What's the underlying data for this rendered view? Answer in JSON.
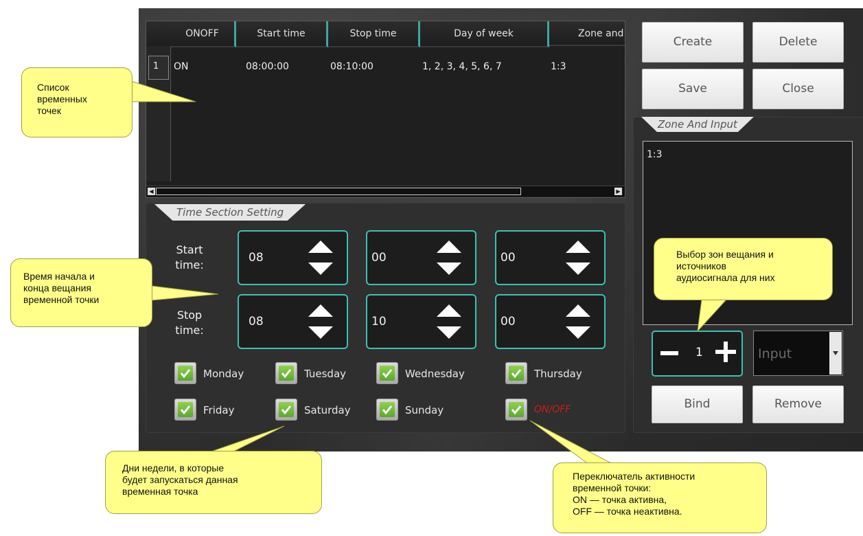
{
  "table": {
    "columns": [
      "ONOFF",
      "Start time",
      "Stop time",
      "Day of week",
      "Zone and"
    ],
    "rows": [
      {
        "num": "1",
        "onoff": "ON",
        "start": "08:00:00",
        "stop": "08:10:00",
        "days": "1, 2, 3, 4, 5, 6, 7",
        "zone": "1:3"
      }
    ]
  },
  "buttons": {
    "create": "Create",
    "delete": "Delete",
    "save": "Save",
    "close": "Close",
    "bind": "Bind",
    "remove": "Remove"
  },
  "zone_panel": {
    "title": "Zone And Input",
    "items": [
      "1:3"
    ],
    "stepper_value": "1",
    "input_placeholder": "Input"
  },
  "time_section": {
    "title": "Time Section Setting",
    "start_label_1": "Start",
    "start_label_2": "time:",
    "stop_label_1": "Stop",
    "stop_label_2": "time:",
    "start": {
      "hour": "08",
      "minute": "00",
      "second": "00"
    },
    "stop": {
      "hour": "08",
      "minute": "10",
      "second": "00"
    },
    "days": {
      "monday": "Monday",
      "tuesday": "Tuesday",
      "wednesday": "Wednesday",
      "thursday": "Thursday",
      "friday": "Friday",
      "saturday": "Saturday",
      "sunday": "Sunday"
    },
    "onoff_label": "ON/OFF",
    "onoff_color": "#d21a1a",
    "accent_color": "#3fbfb5"
  },
  "callouts": {
    "list": "Список\nвременных\nточек",
    "time": "Время начала и\nконца вещания\nвременной точки",
    "zones": "Выбор зон вещания и\nисточников\nаудиосигнала для них",
    "days": "Дни недели, в которые\nбудет запускаться данная\nвременная точка",
    "toggle": "Переключатель активности\nвременной точки:\nON — точка активна,\nOFF — точка неактивна."
  }
}
